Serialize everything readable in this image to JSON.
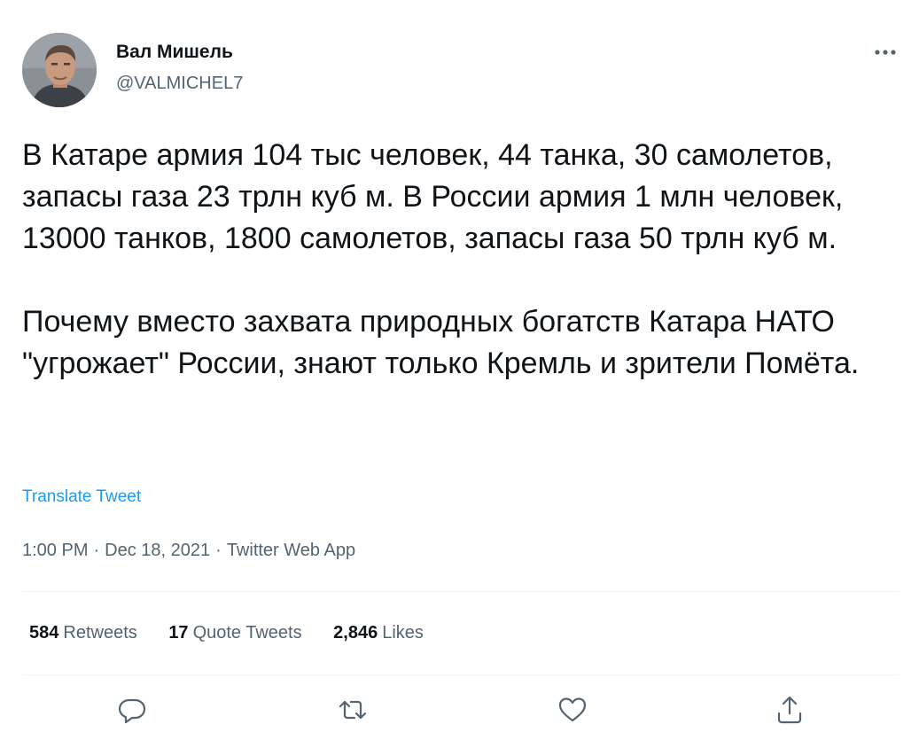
{
  "author": {
    "display_name": "Вал Мишель",
    "handle": "@VALMICHEL7",
    "avatar_icon": "user-avatar-photo"
  },
  "tweet": {
    "paragraphs": [
      "В Катаре армия 104 тыс человек, 44 танка, 30 самолетов, запасы газа 23 трлн куб м. В России армия 1 млн человек, 13000 танков, 1800 самолетов, запасы газа 50 трлн куб м.",
      "Почему вместо захвата природных богатств Катара НАТО \"угрожает\" России, знают только Кремль и зрители Помёта."
    ],
    "translate_label": "Translate Tweet"
  },
  "meta": {
    "time": "1:00 PM",
    "date": "Dec 18, 2021",
    "source": "Twitter Web App",
    "separator": "·"
  },
  "stats": {
    "retweets": {
      "count": "584",
      "label": "Retweets"
    },
    "quote_tweets": {
      "count": "17",
      "label": "Quote Tweets"
    },
    "likes": {
      "count": "2,846",
      "label": "Likes"
    }
  },
  "actions": {
    "reply_icon": "reply-icon",
    "retweet_icon": "retweet-icon",
    "like_icon": "heart-icon",
    "share_icon": "share-icon"
  },
  "colors": {
    "text_primary": "#0f1419",
    "text_secondary": "#536471",
    "link": "#1d9bf0",
    "divider": "#eff3f4"
  }
}
